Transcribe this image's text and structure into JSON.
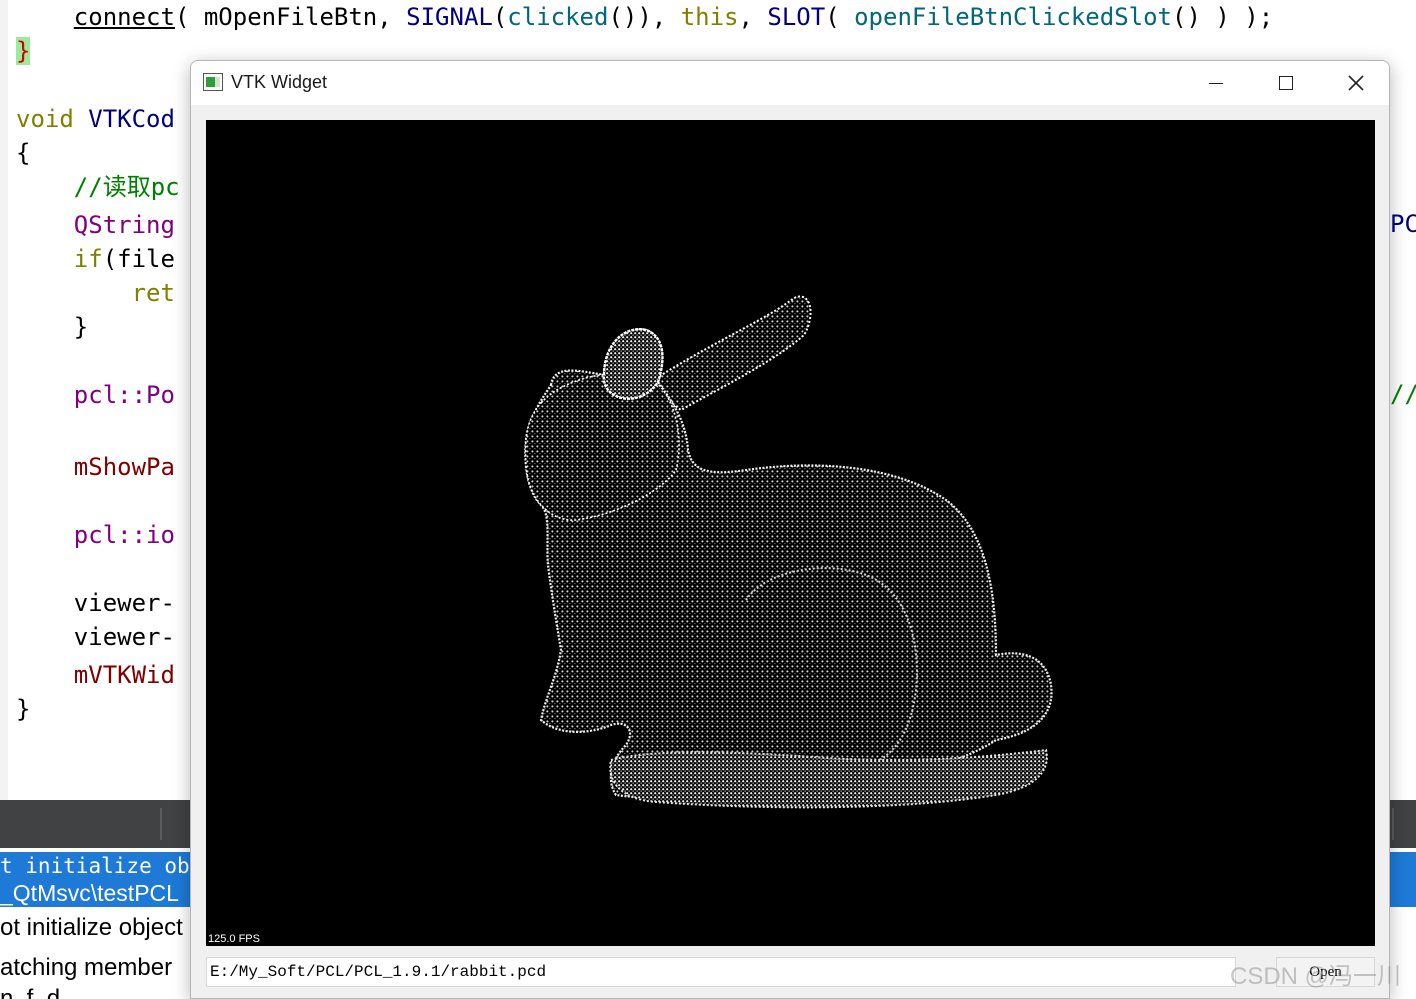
{
  "editor": {
    "lines": [
      {
        "segments": [
          {
            "text": "    ",
            "cls": "k-plain"
          },
          {
            "text": "connect",
            "cls": "k-plain",
            "underline": true
          },
          {
            "text": "( mOpenFileBtn, ",
            "cls": "k-plain"
          },
          {
            "text": "SIGNAL",
            "cls": "k-fn"
          },
          {
            "text": "(",
            "cls": "k-plain"
          },
          {
            "text": "clicked",
            "cls": "k-func"
          },
          {
            "text": "()), ",
            "cls": "k-plain"
          },
          {
            "text": "this",
            "cls": "k-kw"
          },
          {
            "text": ", ",
            "cls": "k-plain"
          },
          {
            "text": "SLOT",
            "cls": "k-fn"
          },
          {
            "text": "( ",
            "cls": "k-plain"
          },
          {
            "text": "openFileBtnClickedSlot",
            "cls": "k-func"
          },
          {
            "text": "() ) );",
            "cls": "k-plain"
          }
        ]
      },
      {
        "segments": [
          {
            "text": "}",
            "cls": "brace-hl"
          }
        ]
      },
      {
        "segments": [
          {
            "text": "void",
            "cls": "k-kw"
          },
          {
            "text": " VTKCod",
            "cls": "k-fn"
          }
        ]
      },
      {
        "segments": [
          {
            "text": "{",
            "cls": "k-plain"
          }
        ]
      },
      {
        "segments": [
          {
            "text": "    //读取pc",
            "cls": "k-cmt"
          }
        ]
      },
      {
        "segments": [
          {
            "text": "    QString",
            "cls": "k-type"
          }
        ]
      },
      {
        "segments": [
          {
            "text": "    ",
            "cls": "k-plain"
          },
          {
            "text": "if",
            "cls": "k-kw"
          },
          {
            "text": "(file",
            "cls": "k-plain"
          }
        ]
      },
      {
        "segments": [
          {
            "text": "        ret",
            "cls": "k-kw"
          }
        ]
      },
      {
        "segments": [
          {
            "text": "    }",
            "cls": "k-plain"
          }
        ]
      },
      {
        "segments": [
          {
            "text": "    pcl::Po",
            "cls": "k-type"
          }
        ]
      },
      {
        "segments": [
          {
            "text": "    mShowPa",
            "cls": "k-mem"
          }
        ]
      },
      {
        "segments": [
          {
            "text": "    pcl::io",
            "cls": "k-type"
          }
        ]
      },
      {
        "segments": [
          {
            "text": "    viewer-",
            "cls": "k-plain"
          }
        ]
      },
      {
        "segments": [
          {
            "text": "    viewer-",
            "cls": "k-plain"
          }
        ]
      },
      {
        "segments": [
          {
            "text": "    mVTKWid",
            "cls": "k-mem"
          }
        ]
      },
      {
        "segments": [
          {
            "text": "}",
            "cls": "k-plain"
          }
        ]
      }
    ],
    "right_fragments": [
      "PC",
      "//"
    ]
  },
  "output": {
    "selected_line_1": "t initialize obj",
    "selected_line_2": "_QtMsvc\\testPCL",
    "line_3": "ot initialize object",
    "line_4": "atching member",
    "line_5": "n  f  d"
  },
  "window": {
    "title": "VTK Widget",
    "fps": "125.0 FPS",
    "file_path": "E:/My_Soft/PCL/PCL_1.9.1/rabbit.pcd",
    "open_label": "Open"
  },
  "watermark": "CSDN @冯一川",
  "colors": {
    "viewport_bg": "#000000",
    "points": "#ffffff",
    "selection": "#1e7ad6",
    "panel_toolbar": "#404244"
  }
}
